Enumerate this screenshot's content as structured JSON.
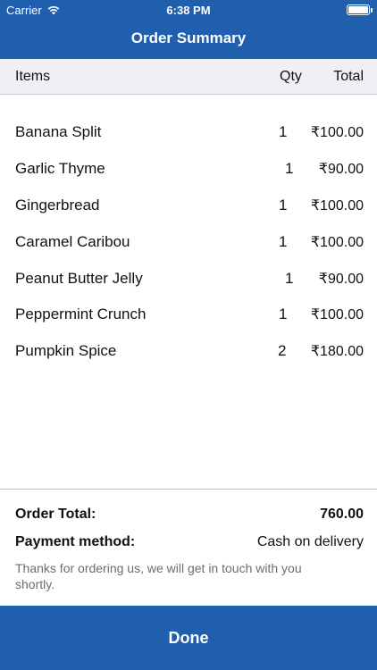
{
  "status_bar": {
    "carrier": "Carrier",
    "time": "6:38 PM"
  },
  "header": {
    "title": "Order Summary"
  },
  "table": {
    "columns": {
      "items": "Items",
      "qty": "Qty",
      "total": "Total"
    },
    "rows": [
      {
        "name": "Banana Split",
        "qty": "1",
        "total": "₹100.00"
      },
      {
        "name": "Garlic Thyme",
        "qty": "1",
        "total": "₹90.00"
      },
      {
        "name": "Gingerbread",
        "qty": "1",
        "total": "₹100.00"
      },
      {
        "name": "Caramel Caribou",
        "qty": "1",
        "total": "₹100.00"
      },
      {
        "name": "Peanut Butter Jelly",
        "qty": "1",
        "total": "₹90.00"
      },
      {
        "name": "Peppermint Crunch",
        "qty": "1",
        "total": "₹100.00"
      },
      {
        "name": "Pumpkin Spice",
        "qty": "2",
        "total": "₹180.00"
      }
    ]
  },
  "summary": {
    "order_total_label": "Order Total:",
    "order_total_value": "760.00",
    "payment_label": "Payment method:",
    "payment_value": "Cash on delivery",
    "note": "Thanks for ordering us, we will get in touch with you shortly."
  },
  "footer": {
    "done_label": "Done"
  },
  "colors": {
    "primary": "#1f5fae",
    "header_row_bg": "#efeff4",
    "note_text": "#6d6d72"
  },
  "icons": [
    "wifi-icon",
    "battery-icon"
  ]
}
